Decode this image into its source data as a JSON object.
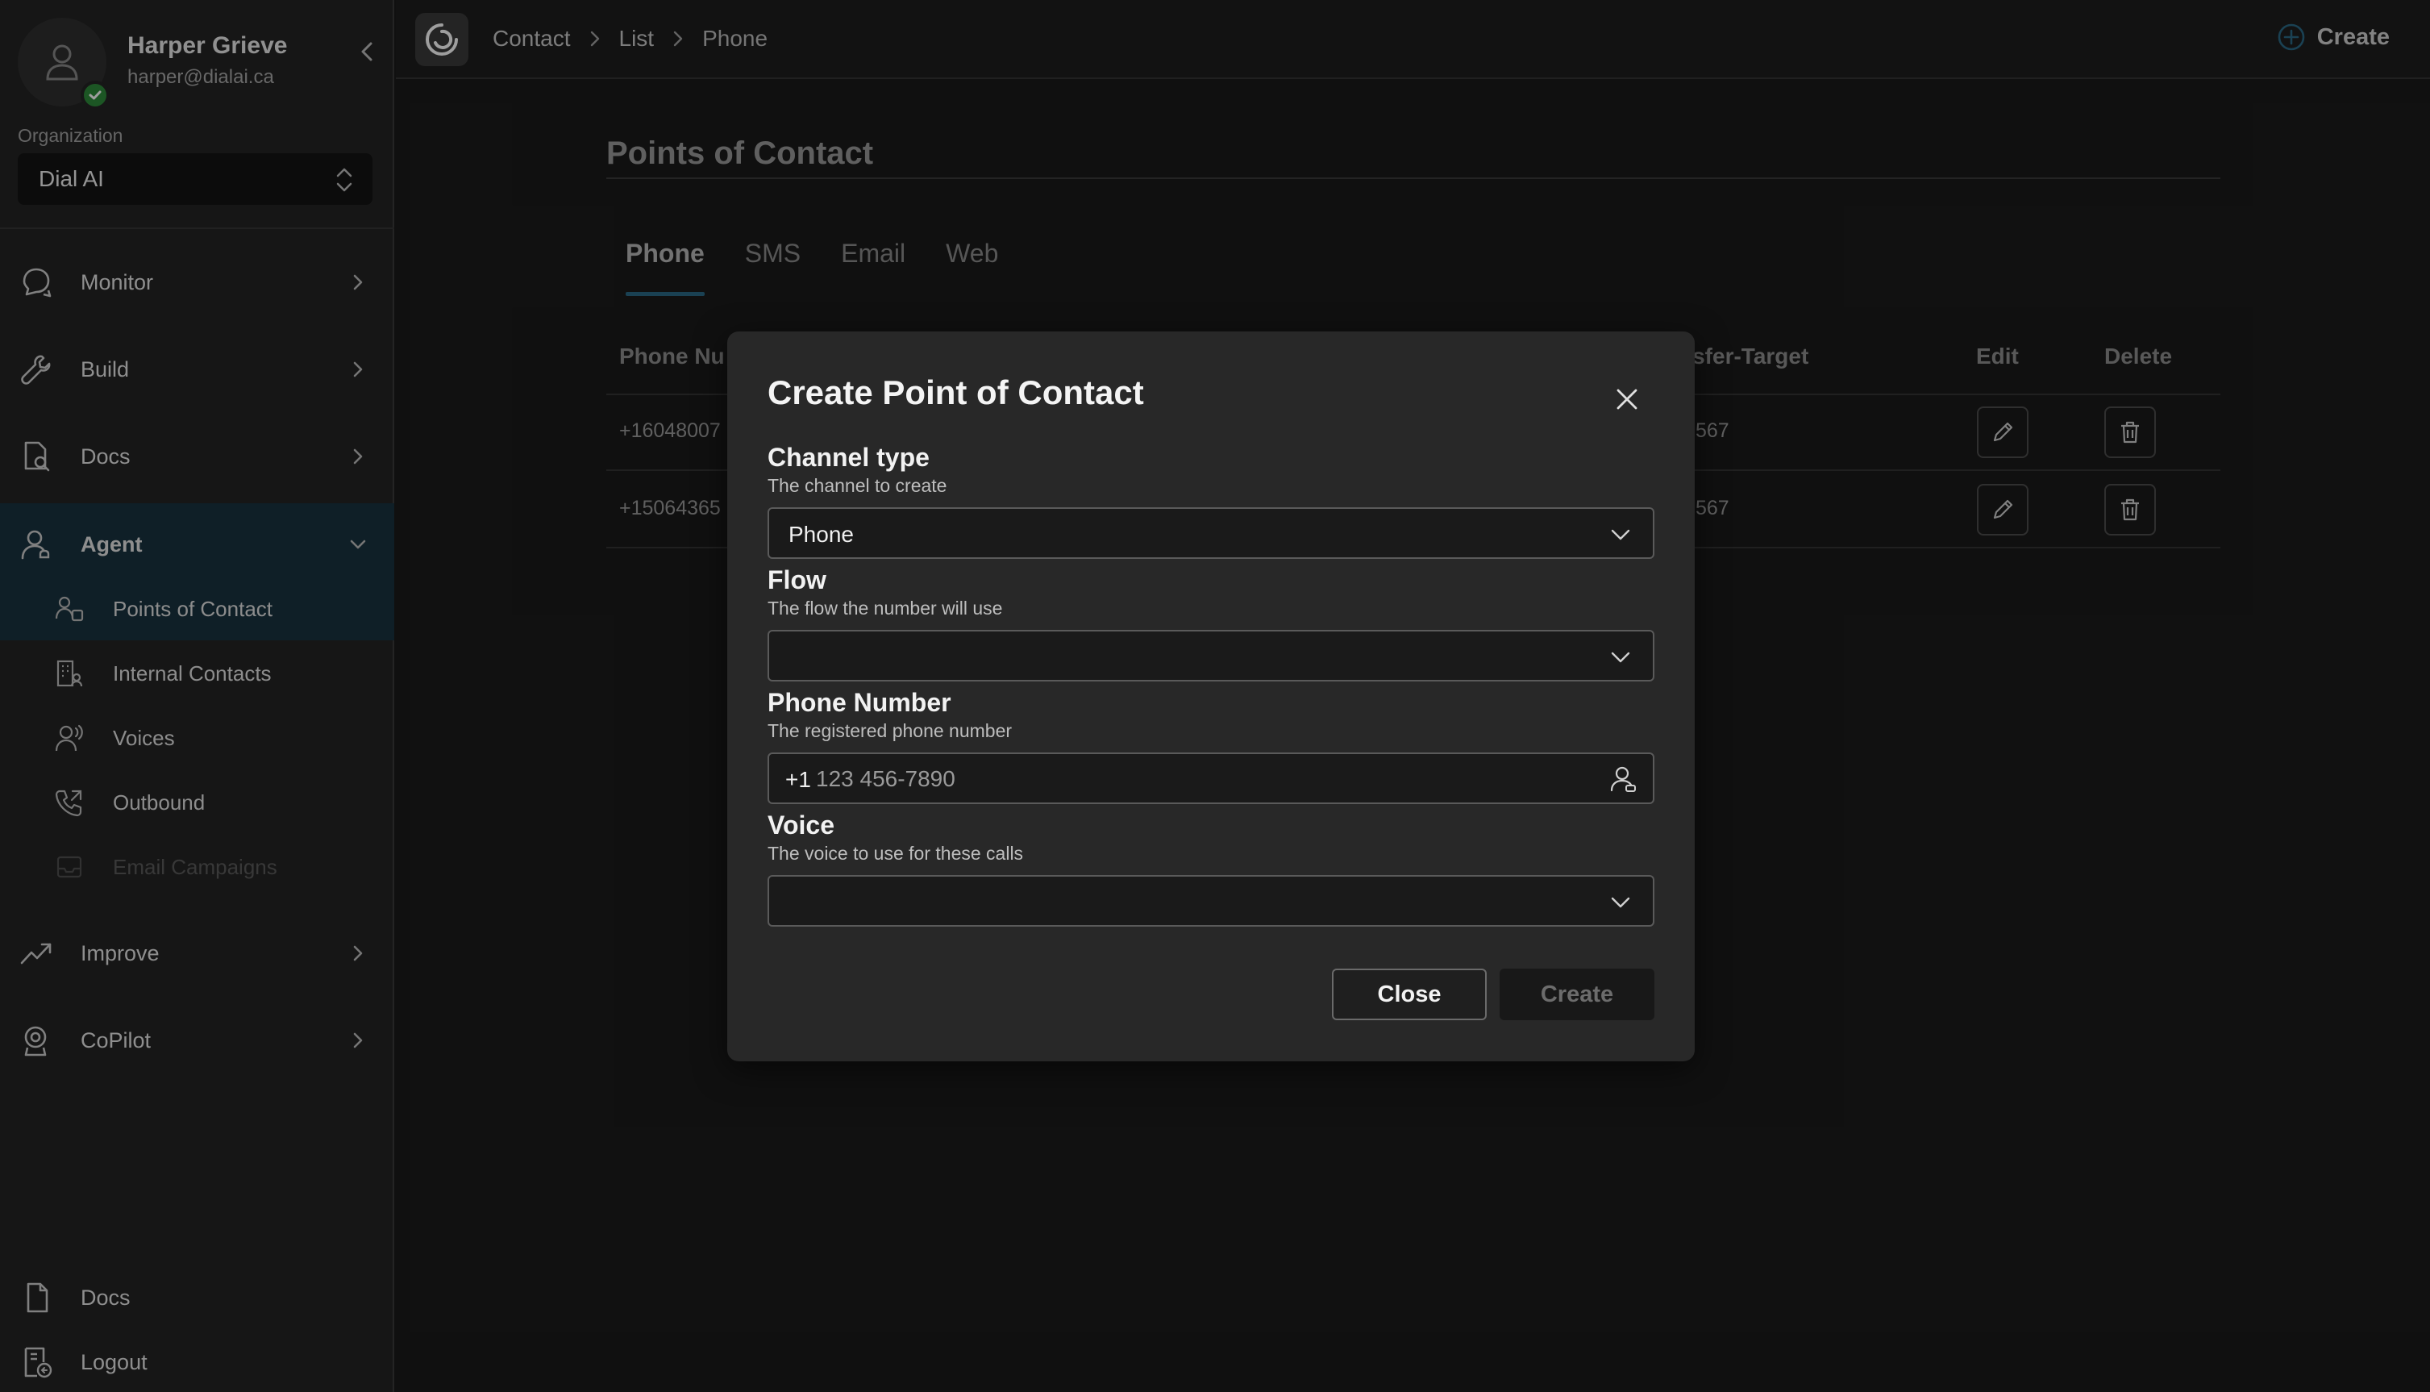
{
  "user": {
    "name": "Harper Grieve",
    "email": "harper@dialai.ca"
  },
  "organization": {
    "label": "Organization",
    "value": "Dial AI"
  },
  "nav": {
    "monitor": "Monitor",
    "build": "Build",
    "docs": "Docs",
    "agent": "Agent",
    "improve": "Improve",
    "copilot": "CoPilot"
  },
  "agent_sub": {
    "points_of_contact": "Points of Contact",
    "internal_contacts": "Internal Contacts",
    "voices": "Voices",
    "outbound": "Outbound",
    "email_campaigns": "Email Campaigns"
  },
  "bottom_nav": {
    "docs": "Docs",
    "logout": "Logout"
  },
  "breadcrumb": [
    "Contact",
    "List",
    "Phone"
  ],
  "top_create_label": "Create",
  "page": {
    "title": "Points of Contact",
    "tabs": [
      "Phone",
      "SMS",
      "Email",
      "Web"
    ]
  },
  "table": {
    "headers": {
      "phone": "Phone Nu",
      "transfer": "nsfer-Target",
      "edit": "Edit",
      "delete": "Delete"
    },
    "rows": [
      {
        "phone": "+16048007",
        "transfer": ".567"
      },
      {
        "phone": "+15064365",
        "transfer": ".567"
      }
    ]
  },
  "modal": {
    "title": "Create Point of Contact",
    "channel": {
      "label": "Channel type",
      "help": "The channel to create",
      "value": "Phone"
    },
    "flow": {
      "label": "Flow",
      "help": "The flow the number will use",
      "value": ""
    },
    "phone": {
      "label": "Phone Number",
      "help": "The registered phone number",
      "prefix": "+1",
      "placeholder": "123 456-7890"
    },
    "voice": {
      "label": "Voice",
      "help": "The voice to use for these calls",
      "value": ""
    },
    "close_label": "Close",
    "create_label": "Create"
  },
  "colors": {
    "background": "#1b1b1b",
    "sidebar": "#242424",
    "active_nav": "#19333f",
    "tab_underline": "#2b6a86",
    "status_green": "#2e8b3a"
  },
  "icons": {
    "sidebar": [
      "user-icon",
      "check-icon",
      "chevron-left-icon",
      "updown-chevron-icon"
    ],
    "nav": [
      "chat-icon",
      "wrench-icon",
      "document-icon",
      "agent-icon",
      "trend-icon",
      "copilot-icon"
    ],
    "table": [
      "pencil-icon",
      "trash-icon"
    ],
    "modal": [
      "close-icon",
      "chevron-down-icon",
      "contact-lookup-icon"
    ]
  }
}
